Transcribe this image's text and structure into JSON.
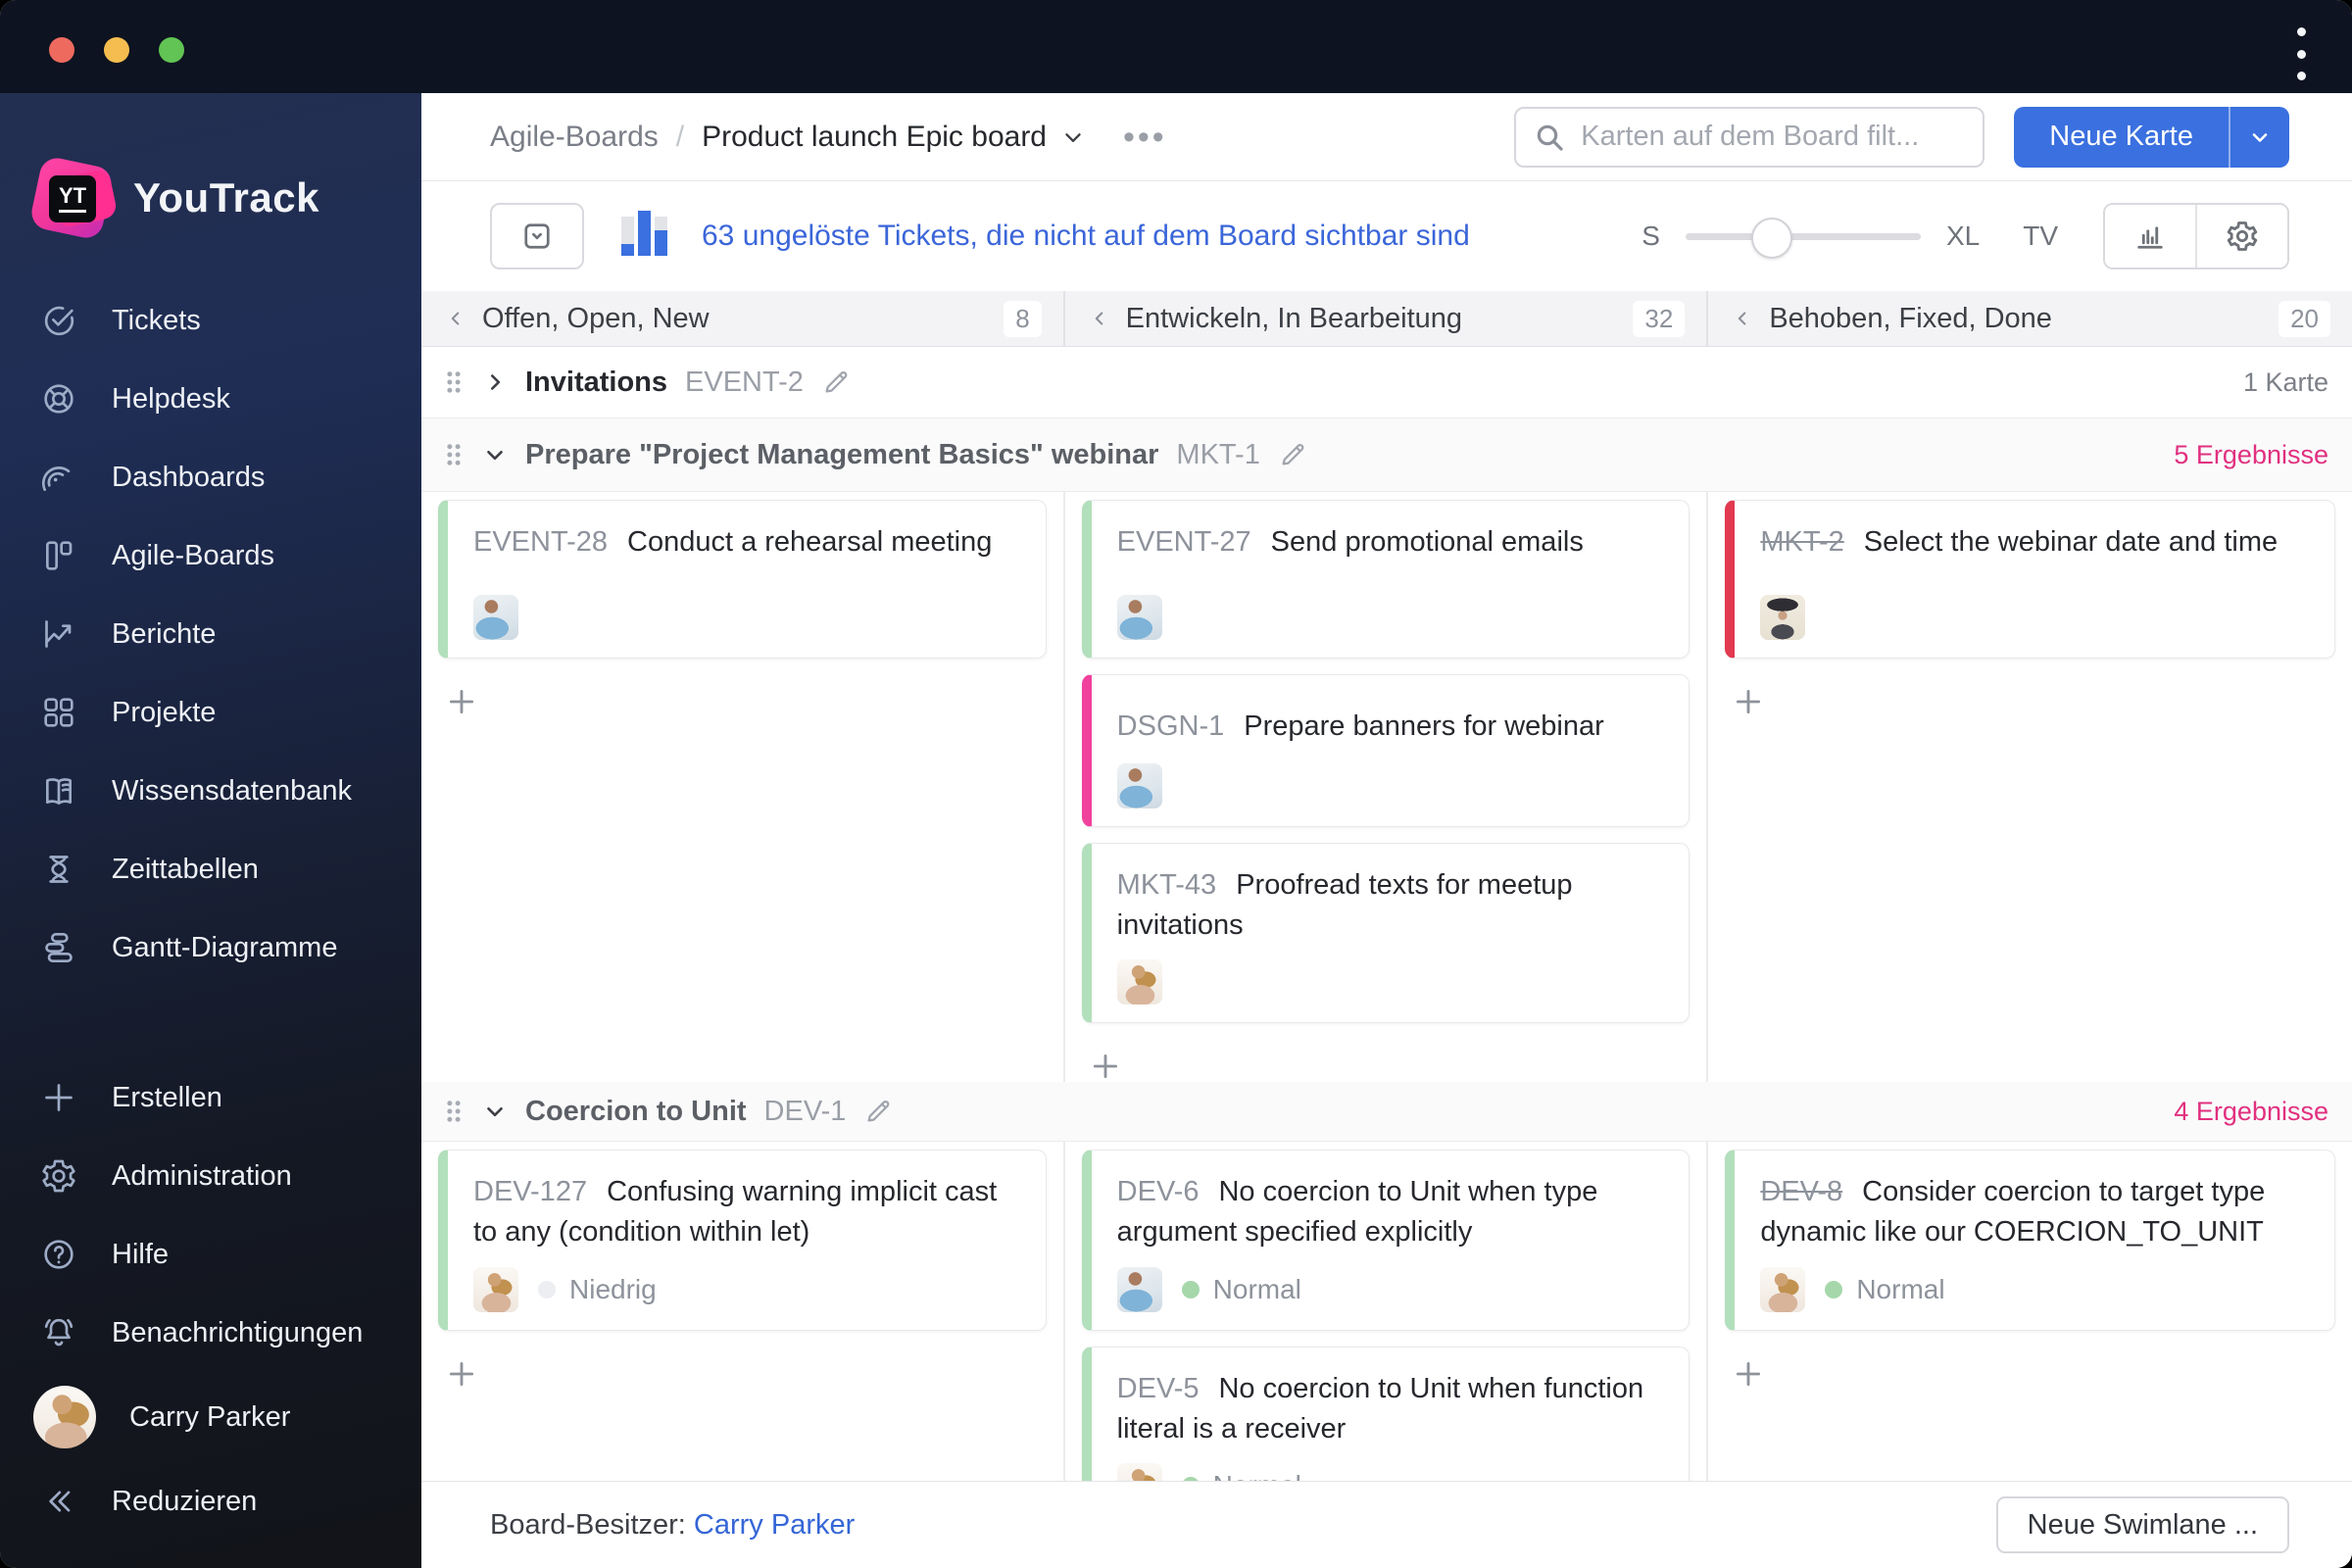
{
  "sidebar": {
    "logo_monogram": "YT",
    "app_name": "YouTrack",
    "items": [
      {
        "label": "Tickets",
        "icon": "check-circle-icon"
      },
      {
        "label": "Helpdesk",
        "icon": "lifebuoy-icon"
      },
      {
        "label": "Dashboards",
        "icon": "gauge-icon"
      },
      {
        "label": "Agile-Boards",
        "icon": "board-columns-icon"
      },
      {
        "label": "Berichte",
        "icon": "line-chart-icon"
      },
      {
        "label": "Projekte",
        "icon": "grid-icon"
      },
      {
        "label": "Wissensdatenbank",
        "icon": "book-icon"
      },
      {
        "label": "Zeittabellen",
        "icon": "hourglass-icon"
      },
      {
        "label": "Gantt-Diagramme",
        "icon": "gantt-bars-icon"
      }
    ],
    "actions": [
      {
        "label": "Erstellen",
        "icon": "plus-icon"
      },
      {
        "label": "Administration",
        "icon": "gear-icon"
      },
      {
        "label": "Hilfe",
        "icon": "question-circle-icon"
      },
      {
        "label": "Benachrichtigungen",
        "icon": "bell-icon"
      }
    ],
    "user": {
      "name": "Carry Parker"
    },
    "collapse_label": "Reduzieren"
  },
  "header": {
    "breadcrumb": {
      "root": "Agile-Boards",
      "separator": "/",
      "current": "Product launch Epic board"
    },
    "search_placeholder": "Karten auf dem Board filt...",
    "new_card_label": "Neue Karte"
  },
  "toolbar": {
    "hidden_link": "63 ungelöste Tickets, die nicht auf dem Board sichtbar sind",
    "size_small": "S",
    "size_large": "XL",
    "tv_label": "TV",
    "slider_position_pct": 28
  },
  "columns": [
    {
      "title": "Offen, Open, New",
      "count": "8"
    },
    {
      "title": "Entwickeln, In Bearbeitung",
      "count": "32"
    },
    {
      "title": "Behoben, Fixed, Done",
      "count": "20"
    }
  ],
  "swimlanes": [
    {
      "title": "Invitations",
      "ref": "EVENT-2",
      "meta": "1 Karte",
      "collapsed": true
    },
    {
      "title": "Prepare \"Project Management Basics\" webinar",
      "ref": "MKT-1",
      "meta": "5 Ergebnisse",
      "columns": [
        {
          "cards": [
            {
              "id": "EVENT-28",
              "title": "Conduct a rehearsal meeting",
              "accent": "green",
              "avatar": "man"
            }
          ]
        },
        {
          "cards": [
            {
              "id": "EVENT-27",
              "title": "Send promotional emails",
              "accent": "green",
              "avatar": "man"
            },
            {
              "id": "DSGN-1",
              "title": "Prepare banners for webinar",
              "accent": "pink",
              "avatar": "man"
            },
            {
              "id": "MKT-43",
              "title": "Proofread texts for meetup invitations",
              "accent": "green",
              "avatar": "woman"
            }
          ]
        },
        {
          "cards": [
            {
              "id": "MKT-2",
              "title": "Select the webinar date and time",
              "accent": "red",
              "resolved": true,
              "avatar": "hat"
            }
          ]
        }
      ]
    },
    {
      "title": "Coercion to Unit",
      "ref": "DEV-1",
      "meta": "4 Ergebnisse",
      "columns": [
        {
          "cards": [
            {
              "id": "DEV-127",
              "title": "Confusing warning implicit cast to any (condition within let)",
              "accent": "green",
              "avatar": "woman",
              "priority": "Niedrig",
              "priority_level": "low"
            }
          ]
        },
        {
          "cards": [
            {
              "id": "DEV-6",
              "title": "No coercion to Unit when type argument specified explicitly",
              "accent": "green",
              "avatar": "man",
              "priority": "Normal",
              "priority_level": "normal"
            },
            {
              "id": "DEV-5",
              "title": "No coercion to Unit when function literal is a receiver",
              "accent": "green",
              "avatar": "woman",
              "priority": "Normal",
              "priority_level": "normal"
            }
          ]
        },
        {
          "cards": [
            {
              "id": "DEV-8",
              "title": "Consider coercion to target type dynamic like our COERCION_TO_UNIT",
              "accent": "green",
              "resolved": true,
              "avatar": "woman",
              "priority": "Normal",
              "priority_level": "normal"
            }
          ]
        }
      ]
    }
  ],
  "footer": {
    "owner_label": "Board-Besitzer:",
    "owner_name": "Carry Parker",
    "new_swimlane_label": "Neue Swimlane ..."
  },
  "colors": {
    "primary_blue": "#3a70df",
    "link_blue": "#3566d6",
    "results_pink": "#e1307f",
    "accent_green": "#b2dfbc",
    "accent_red": "#e23950",
    "accent_pink": "#f0419c",
    "priority_normal": "#a6d7ab",
    "priority_low": "#eceef1",
    "titlebar_bg": "#0d1320"
  }
}
